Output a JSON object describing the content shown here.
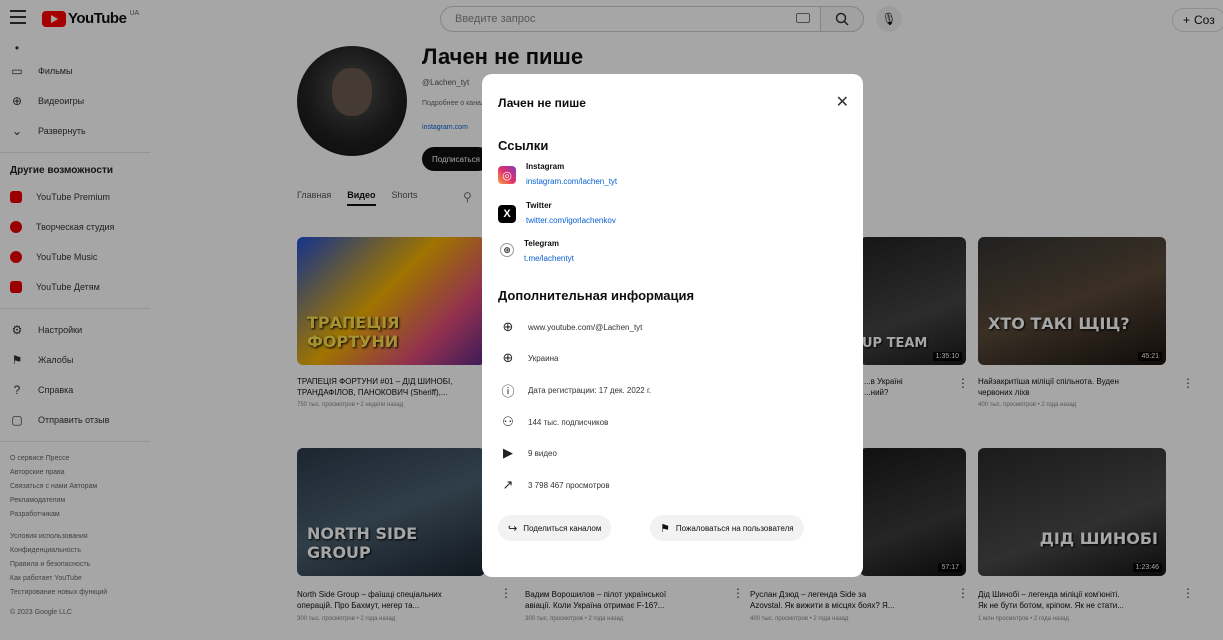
{
  "header": {
    "logo_text": "YouTube",
    "logo_cc": "UA",
    "search_placeholder": "Введите запрос",
    "create_label": "Соз"
  },
  "sidebar": {
    "items_top": [
      {
        "label": "Фильмы",
        "icon": "film-icon"
      },
      {
        "label": "Видеоигры",
        "icon": "gamepad-icon"
      },
      {
        "label": "Развернуть",
        "icon": "chevron-down-icon"
      }
    ],
    "other_heading": "Другие возможности",
    "other_items": [
      {
        "label": "YouTube Premium",
        "icon": "youtube-premium-icon"
      },
      {
        "label": "Творческая студия",
        "icon": "youtube-studio-icon"
      },
      {
        "label": "YouTube Music",
        "icon": "youtube-music-icon"
      },
      {
        "label": "YouTube Детям",
        "icon": "youtube-kids-icon"
      }
    ],
    "settings_items": [
      {
        "label": "Настройки",
        "icon": "gear-icon"
      },
      {
        "label": "Жалобы",
        "icon": "flag-icon"
      },
      {
        "label": "Справка",
        "icon": "help-icon"
      },
      {
        "label": "Отправить отзыв",
        "icon": "feedback-icon"
      }
    ],
    "footer_lines_1": [
      "О сервисе  Прессе",
      "Авторские права",
      "Связаться с нами  Авторам",
      "Рекламодателям",
      "Разработчикам"
    ],
    "footer_lines_2": [
      "Условия использования",
      "Конфиденциальность",
      "Правила и безопасность",
      "Как работает YouTube",
      "Тестирование новых функций"
    ],
    "copyright": "© 2023 Google LLC"
  },
  "channel": {
    "title": "Лачен не пише",
    "handle": "@Lachen_tyt",
    "description": "Подробнее о канале",
    "link": "instagram.com",
    "subscribe_label": "Подписаться",
    "tabs": [
      "Главная",
      "Видео",
      "Shorts"
    ],
    "active_tab": "Видео"
  },
  "videos": [
    {
      "title_l1": "ТРАПЕЦІЯ ФОРТУНИ #01 – ДІД ШИНОБІ,",
      "title_l2": "ТРАНДАФІЛОВ, ПАНОКОВИЧ (Sheriff),...",
      "meta": "750 тыс. просмотров • 2 недели назад",
      "caption": "ТРАПЕЦІЯ ФОРТУНИ",
      "duration": ""
    },
    {
      "title_l1": "North Side Group – фаїшці спеціальних",
      "title_l2": "операцій. Про Бахмут, негер та...",
      "meta": "300 тыс. просмотров • 2 года назад",
      "caption": "NORTH SIDE GROUP",
      "duration": ""
    },
    {
      "title_l1": "...в Україні",
      "title_l2": "...ний?",
      "meta": "",
      "caption": "UP TEAM",
      "duration": "1:35:10"
    },
    {
      "title_l1": "Найзакритіша міліції спільнота. Вуден",
      "title_l2": "червоних ліхв",
      "meta": "400 тыс. просмотров • 2 года назад",
      "caption": "ХТО ТАКІ ЩІЦ?",
      "duration": "45:21"
    },
    {
      "title_l1": "Вадим Ворошилов – пілот української",
      "title_l2": "авіації. Коли Україна отримає F-16?...",
      "meta": "300 тыс. просмотров • 2 года назад",
      "caption": "",
      "duration": ""
    },
    {
      "title_l1": "Руслан Дзюд – легенда Side за",
      "title_l2": "Azovstal. Як вижити в місцях боях? Я...",
      "meta": "400 тыс. просмотров • 2 года назад",
      "caption": "",
      "duration": "57:17"
    },
    {
      "title_l1": "Дід Шинобі – легенда міліції ком'юніті.",
      "title_l2": "Як не бути ботом, кріпом. Як не стати...",
      "meta": "1 млн просмотров • 2 года назад",
      "caption": "ДІД ШИНОБІ",
      "duration": "1:23:46"
    }
  ],
  "modal": {
    "title": "Лачен не пише",
    "links_heading": "Ссылки",
    "links": [
      {
        "name": "Instagram",
        "url": "instagram.com/lachen_tyt",
        "icon": "instagram-icon"
      },
      {
        "name": "Twitter",
        "url": "twitter.com/igorlachenkov",
        "icon": "twitter-x-icon"
      },
      {
        "name": "Telegram",
        "url": "t.me/lachentyt",
        "icon": "globe-icon"
      }
    ],
    "info_heading": "Дополнительная информация",
    "info": [
      {
        "text": "www.youtube.com/@Lachen_tyt",
        "icon": "globe-icon"
      },
      {
        "text": "Украина",
        "icon": "globe-icon"
      },
      {
        "text": "Дата регистрации: 17 дек. 2022 г.",
        "icon": "info-icon"
      },
      {
        "text": "144 тыс. подписчиков",
        "icon": "subscribers-icon"
      },
      {
        "text": "9 видео",
        "icon": "video-icon"
      },
      {
        "text": "3 798 467 просмотров",
        "icon": "trending-icon"
      }
    ],
    "share_label": "Поделиться каналом",
    "report_label": "Пожаловаться на пользователя"
  }
}
